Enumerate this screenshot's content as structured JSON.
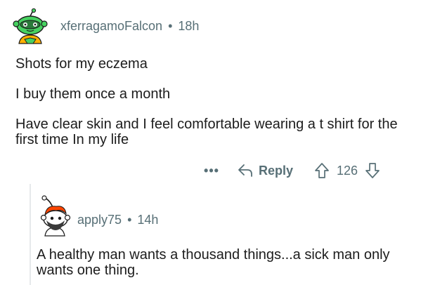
{
  "comment": {
    "username": "xferragamoFalcon",
    "separator": "•",
    "age": "18h",
    "paragraphs": [
      "Shots for my eczema",
      "I buy them once a month",
      "Have clear skin and I feel comfortable wearing a t shirt for the first time In my life"
    ],
    "actions": {
      "more": "•••",
      "reply_label": "Reply",
      "vote_count": "126"
    }
  },
  "reply": {
    "username": "apply75",
    "separator": "•",
    "age": "14h",
    "text": "A healthy man wants a thousand things...a sick man only wants one thing."
  },
  "icons": {
    "more": "ellipsis-icon",
    "reply": "reply-arrow-icon",
    "upvote": "upvote-arrow-icon",
    "downvote": "downvote-arrow-icon"
  },
  "colors": {
    "meta_text": "#576f76",
    "body_text": "#1c1c1c",
    "thread_line": "#e6e9eb",
    "avatar_1_bg": "#46d160",
    "avatar_2_hair": "#ff4500"
  }
}
